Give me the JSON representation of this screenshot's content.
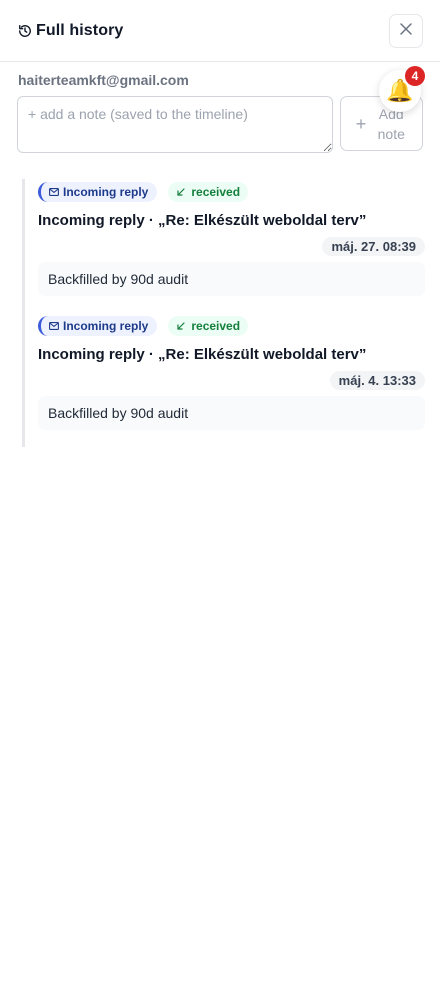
{
  "header": {
    "title": "Full history",
    "history_icon": "history-icon",
    "close_icon": "close-icon"
  },
  "contact": {
    "email": "haiterteamkft@gmail.com"
  },
  "note": {
    "placeholder": "+ add a note (saved to the timeline)",
    "value": "",
    "add_button_label": "Add note",
    "add_icon": "plus-icon"
  },
  "notifications": {
    "icon": "bell-icon",
    "count": "4"
  },
  "timeline": {
    "entries": [
      {
        "type_label": "Incoming reply",
        "type_icon": "mail-icon",
        "status_label": "received",
        "status_icon": "arrow-down-left-icon",
        "title": "Incoming reply · „Re: Elkészült weboldal terv”",
        "timestamp": "máj. 27. 08:39",
        "body": "Backfilled by 90d audit"
      },
      {
        "type_label": "Incoming reply",
        "type_icon": "mail-icon",
        "status_label": "received",
        "status_icon": "arrow-down-left-icon",
        "title": "Incoming reply · „Re: Elkészült weboldal terv”",
        "timestamp": "máj. 4. 13:33",
        "body": "Backfilled by 90d audit"
      }
    ]
  },
  "colors": {
    "accent_blue": "#3b5bdb",
    "status_green": "#15803d",
    "badge_red": "#dc2626",
    "border": "#e5e7eb"
  }
}
